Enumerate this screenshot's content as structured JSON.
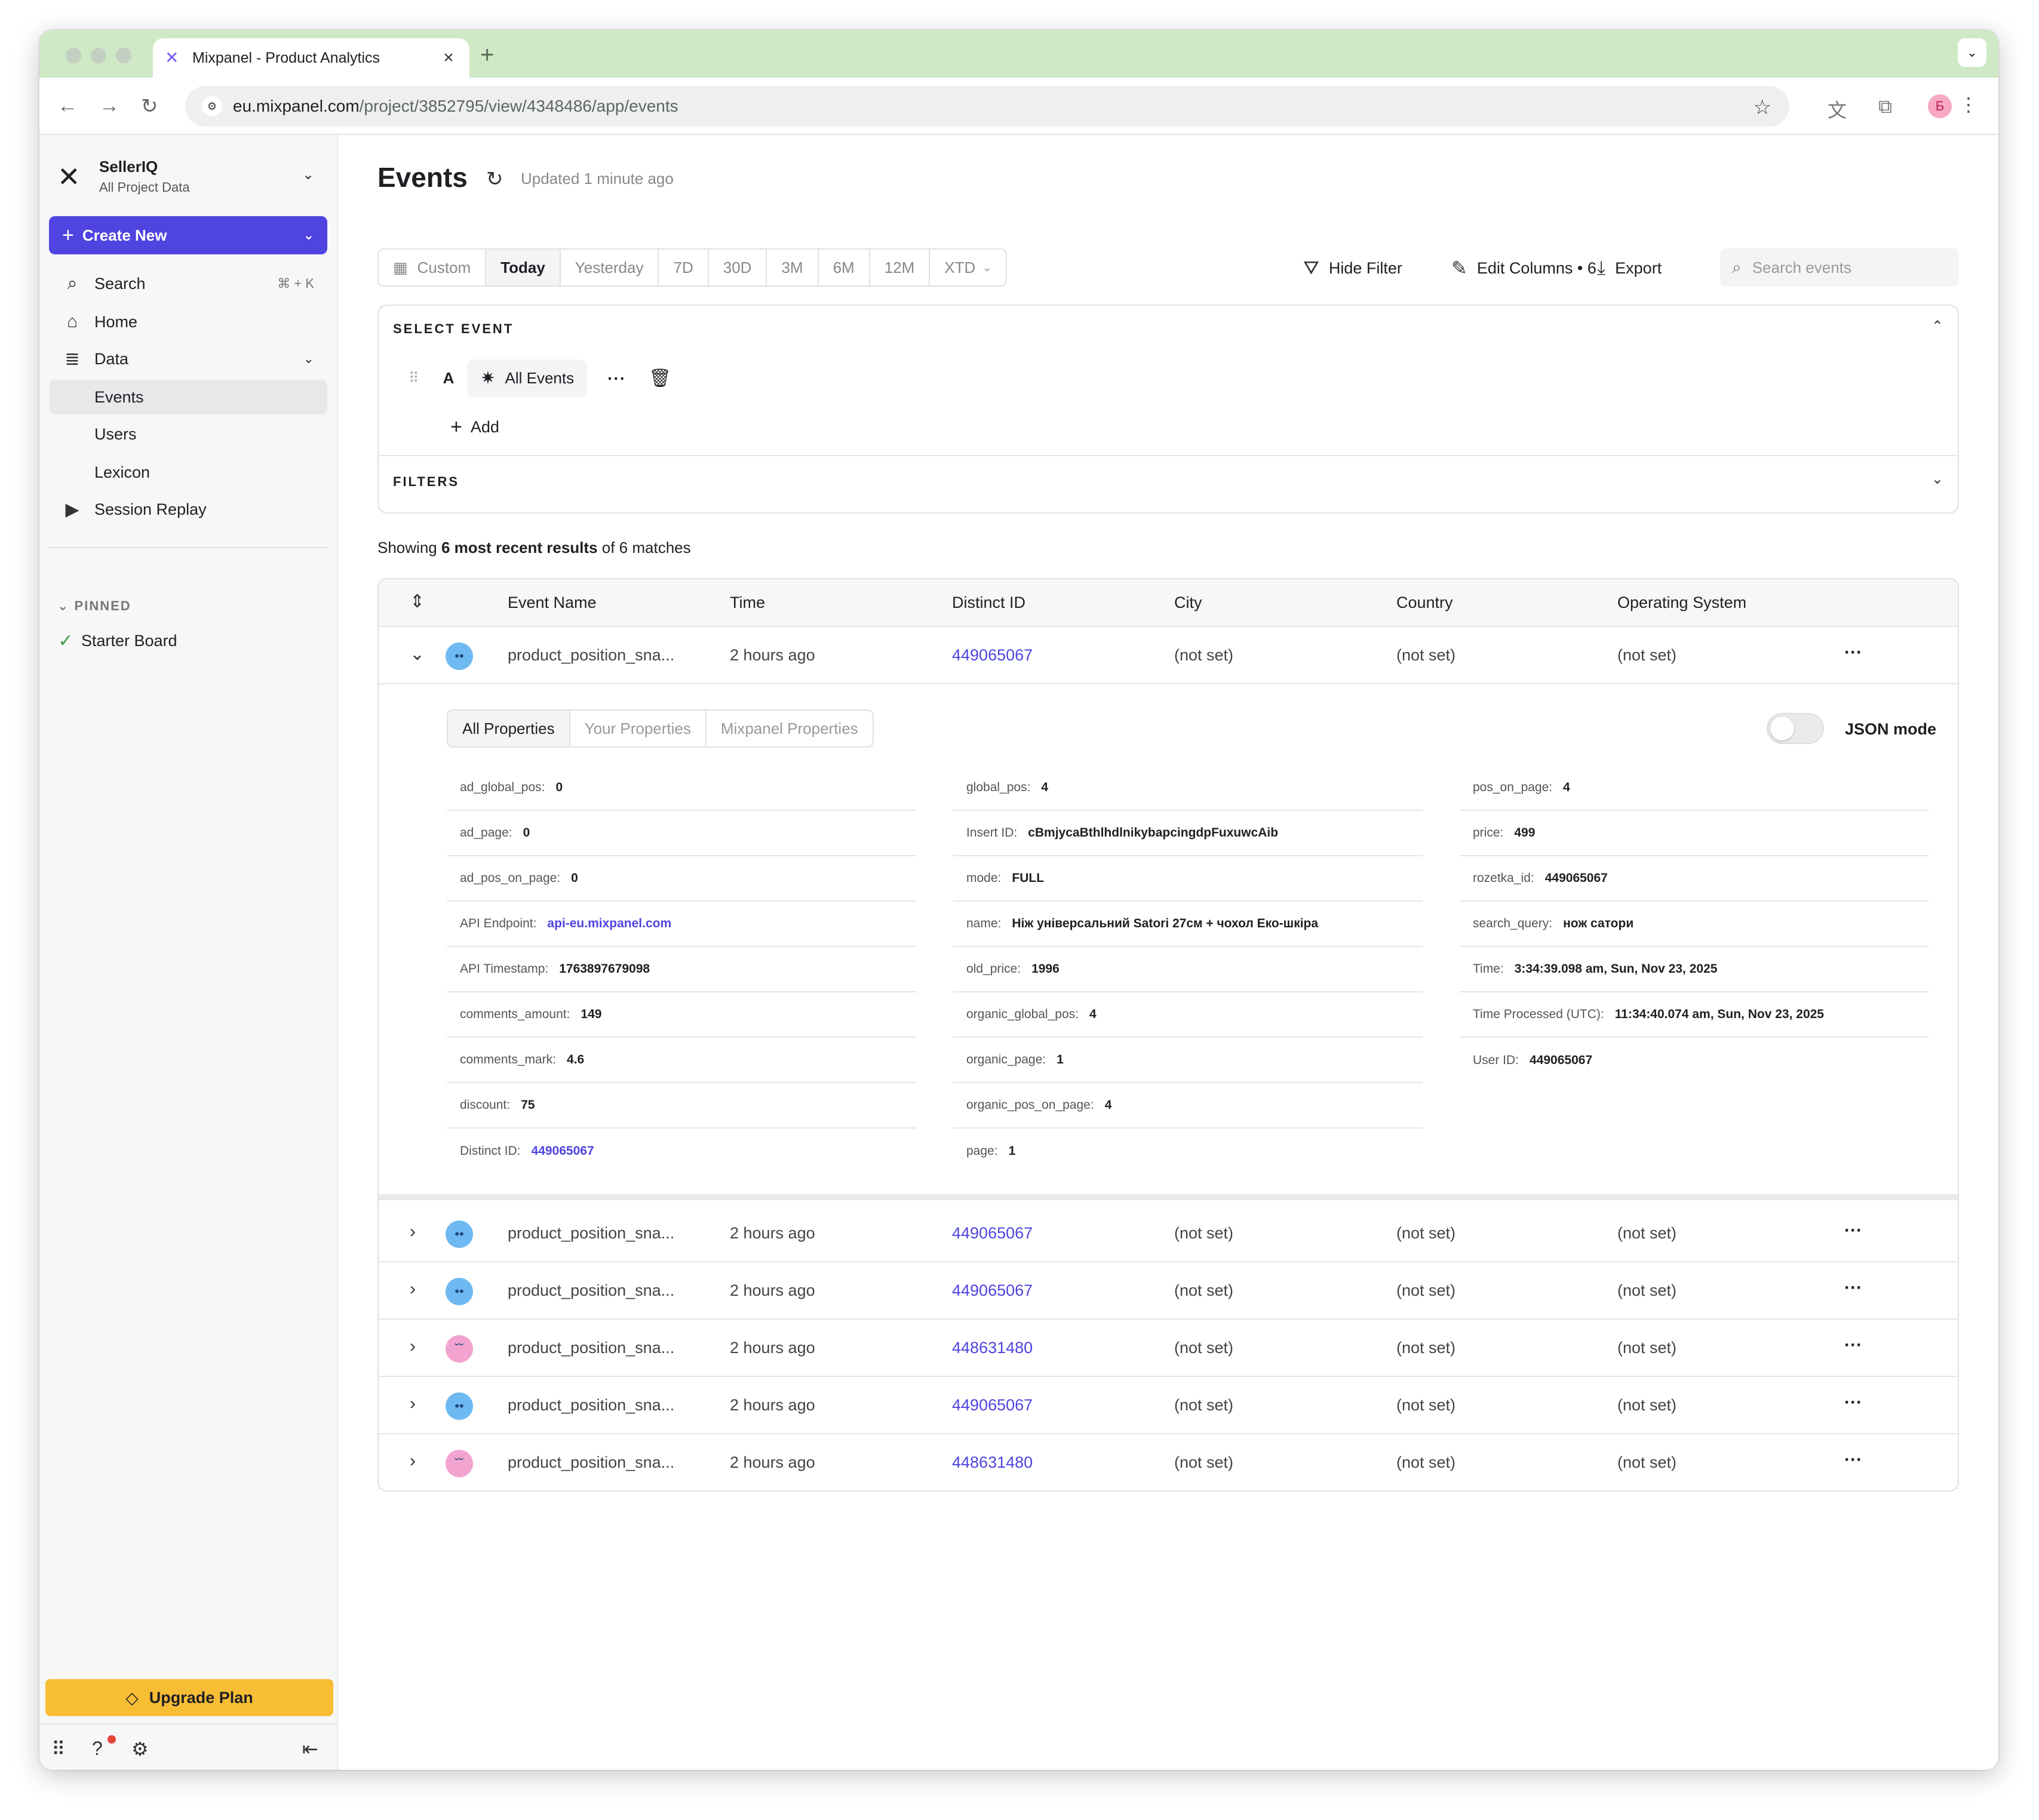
{
  "browser": {
    "tab_title": "Mixpanel - Product Analytics",
    "url_host": "eu.mixpanel.com",
    "url_path": "/project/3852795/view/4348486/app/events",
    "profile_initial": "Б"
  },
  "sidebar": {
    "project_name": "SellerIQ",
    "project_sub": "All Project Data",
    "create_label": "Create New",
    "search_label": "Search",
    "search_shortcut": "⌘ + K",
    "home_label": "Home",
    "data_label": "Data",
    "data_items": [
      "Events",
      "Users",
      "Lexicon"
    ],
    "session_replay_label": "Session Replay",
    "pinned_header": "PINNED",
    "pinned_items": [
      "Starter Board"
    ],
    "upgrade_label": "Upgrade Plan"
  },
  "header": {
    "title": "Events",
    "updated": "Updated 1 minute ago"
  },
  "ranges": [
    "Custom",
    "Today",
    "Yesterday",
    "7D",
    "30D",
    "3M",
    "6M",
    "12M",
    "XTD"
  ],
  "active_range": "Today",
  "toolbar": {
    "hide_filter": "Hide Filter",
    "edit_columns": "Edit Columns • 6",
    "export": "Export",
    "search_placeholder": "Search events"
  },
  "select_event": {
    "header": "SELECT EVENT",
    "letter": "A",
    "event_label": "All Events",
    "add_label": "Add",
    "filters_header": "FILTERS"
  },
  "results": {
    "prefix": "Showing ",
    "bold": "6 most recent results",
    "suffix": " of 6 matches"
  },
  "table": {
    "columns": [
      "Event Name",
      "Time",
      "Distinct ID",
      "City",
      "Country",
      "Operating System"
    ],
    "rows": [
      {
        "event": "product_position_sna...",
        "time": "2 hours ago",
        "distinct_id": "449065067",
        "city": "(not set)",
        "country": "(not set)",
        "os": "(not set)",
        "avatar_color": "#6eb9f2",
        "expanded": true
      },
      {
        "event": "product_position_sna...",
        "time": "2 hours ago",
        "distinct_id": "449065067",
        "city": "(not set)",
        "country": "(not set)",
        "os": "(not set)",
        "avatar_color": "#6eb9f2",
        "expanded": false
      },
      {
        "event": "product_position_sna...",
        "time": "2 hours ago",
        "distinct_id": "449065067",
        "city": "(not set)",
        "country": "(not set)",
        "os": "(not set)",
        "avatar_color": "#6eb9f2",
        "expanded": false
      },
      {
        "event": "product_position_sna...",
        "time": "2 hours ago",
        "distinct_id": "448631480",
        "city": "(not set)",
        "country": "(not set)",
        "os": "(not set)",
        "avatar_color": "#f2a3cf",
        "expanded": false
      },
      {
        "event": "product_position_sna...",
        "time": "2 hours ago",
        "distinct_id": "449065067",
        "city": "(not set)",
        "country": "(not set)",
        "os": "(not set)",
        "avatar_color": "#6eb9f2",
        "expanded": false
      },
      {
        "event": "product_position_sna...",
        "time": "2 hours ago",
        "distinct_id": "448631480",
        "city": "(not set)",
        "country": "(not set)",
        "os": "(not set)",
        "avatar_color": "#f2a3cf",
        "expanded": false
      }
    ]
  },
  "detail": {
    "tabs": [
      "All Properties",
      "Your Properties",
      "Mixpanel Properties"
    ],
    "json_mode_label": "JSON mode",
    "columns": [
      [
        {
          "k": "ad_global_pos:",
          "v": "0"
        },
        {
          "k": "ad_page:",
          "v": "0"
        },
        {
          "k": "ad_pos_on_page:",
          "v": "0"
        },
        {
          "k": "API Endpoint:",
          "v": "api-eu.mixpanel.com",
          "link": true
        },
        {
          "k": "API Timestamp:",
          "v": "1763897679098"
        },
        {
          "k": "comments_amount:",
          "v": "149"
        },
        {
          "k": "comments_mark:",
          "v": "4.6"
        },
        {
          "k": "discount:",
          "v": "75"
        },
        {
          "k": "Distinct ID:",
          "v": "449065067",
          "link": true
        }
      ],
      [
        {
          "k": "global_pos:",
          "v": "4"
        },
        {
          "k": "Insert ID:",
          "v": "cBmjycaBthlhdlnikybapcingdpFuxuwcAib"
        },
        {
          "k": "mode:",
          "v": "FULL"
        },
        {
          "k": "name:",
          "v": "Ніж універсальний Satori 27см + чохол Еко-шкіра"
        },
        {
          "k": "old_price:",
          "v": "1996"
        },
        {
          "k": "organic_global_pos:",
          "v": "4"
        },
        {
          "k": "organic_page:",
          "v": "1"
        },
        {
          "k": "organic_pos_on_page:",
          "v": "4"
        },
        {
          "k": "page:",
          "v": "1"
        }
      ],
      [
        {
          "k": "pos_on_page:",
          "v": "4"
        },
        {
          "k": "price:",
          "v": "499"
        },
        {
          "k": "rozetka_id:",
          "v": "449065067"
        },
        {
          "k": "search_query:",
          "v": "нож сатори"
        },
        {
          "k": "Time:",
          "v": "3:34:39.098 am, Sun, Nov 23, 2025"
        },
        {
          "k": "Time Processed (UTC):",
          "v": "11:34:40.074 am, Sun, Nov 23, 2025"
        },
        {
          "k": "User ID:",
          "v": "449065067"
        }
      ]
    ]
  },
  "colors": {
    "accent": "#4f44e0",
    "upgrade": "#f7bd34",
    "tabbar": "#cfe8c6"
  }
}
